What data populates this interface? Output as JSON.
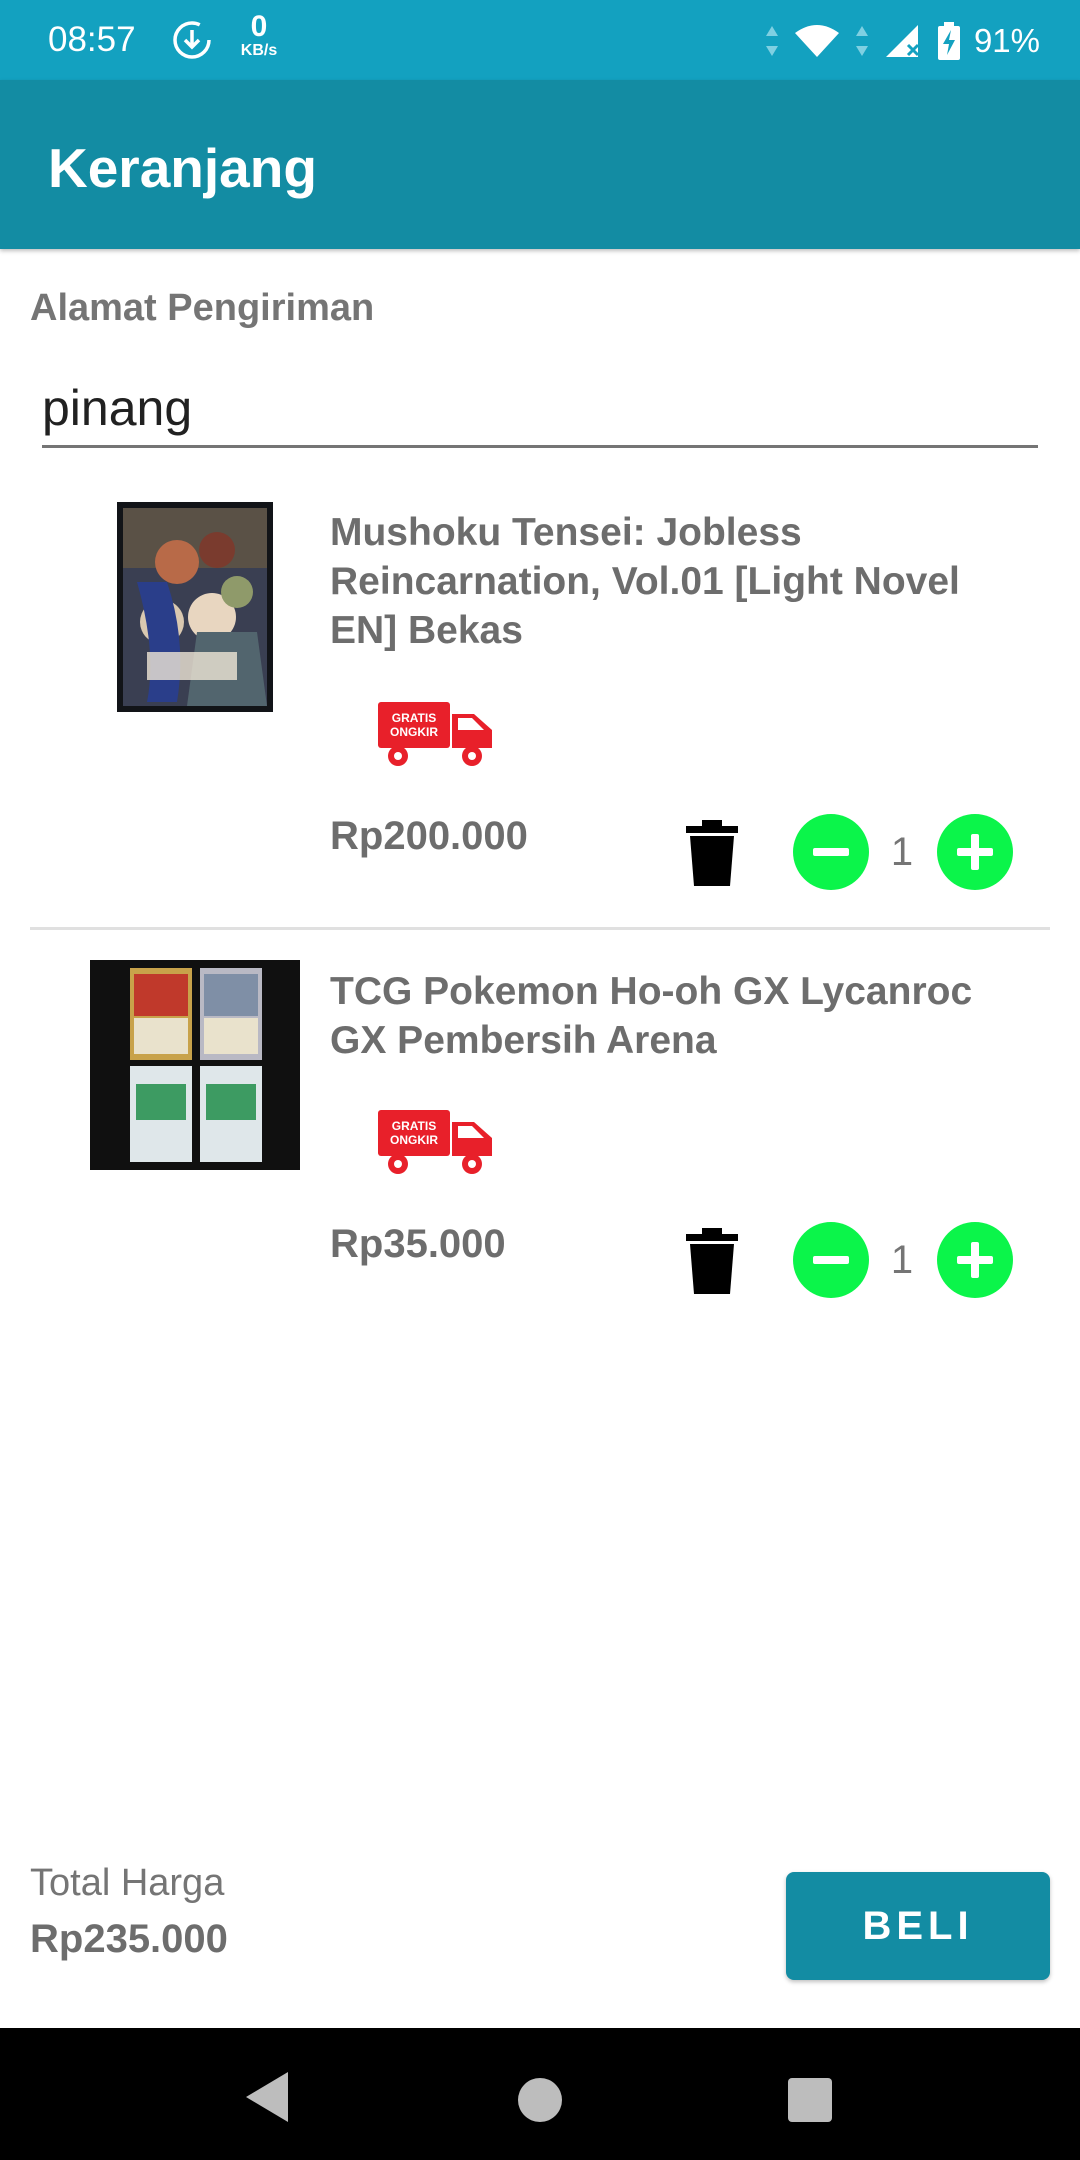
{
  "status_bar": {
    "time": "08:57",
    "speed_value": "0",
    "speed_unit": "KB/s",
    "battery": "91%",
    "icons": [
      "download-icon",
      "data-arrows-icon",
      "wifi-icon",
      "signal-icon",
      "battery-charging-icon"
    ]
  },
  "app_bar": {
    "title": "Keranjang"
  },
  "address": {
    "label": "Alamat Pengiriman",
    "value": "pinang"
  },
  "items": [
    {
      "name": "Mushoku Tensei: Jobless Reincarnation, Vol.01 [Light Novel EN] Bekas",
      "badge_line1": "GRATIS",
      "badge_line2": "ONGKIR",
      "price": "Rp200.000",
      "quantity": "1"
    },
    {
      "name": "TCG Pokemon Ho-oh GX Lycanroc GX Pembersih Arena",
      "badge_line1": "GRATIS",
      "badge_line2": "ONGKIR",
      "price": "Rp35.000",
      "quantity": "1"
    }
  ],
  "footer": {
    "total_label": "Total Harga",
    "total_value": "Rp235.000",
    "buy_label": "BELI"
  },
  "colors": {
    "status_bar": "#13a1c0",
    "app_bar": "#138ca3",
    "qty_button": "#0bf54a",
    "ongkir_red": "#e8202a",
    "text_grey": "#6d6d6d"
  }
}
